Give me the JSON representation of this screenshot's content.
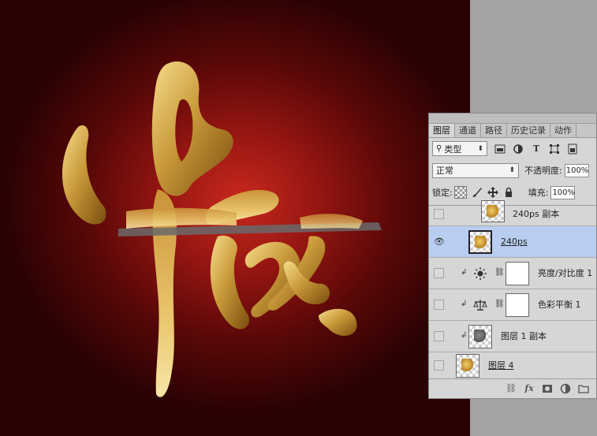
{
  "panel": {
    "tabs": [
      {
        "label": "图层",
        "active": true
      },
      {
        "label": "通道"
      },
      {
        "label": "路径"
      },
      {
        "label": "历史记录"
      },
      {
        "label": "动作"
      }
    ],
    "filter": {
      "kind_label": "类型"
    },
    "blend": {
      "mode": "正常",
      "opacity_label": "不透明度:",
      "opacity_value": "100%"
    },
    "lock": {
      "label": "锁定:",
      "fill_label": "填充:",
      "fill_value": "100%"
    },
    "layers": [
      {
        "name": "240ps 副本",
        "visible": false
      },
      {
        "name": "240ps",
        "visible": true,
        "selected": true
      },
      {
        "name": "亮度/对比度 1",
        "visible": false,
        "clipped": true,
        "icon": "sun-icon"
      },
      {
        "name": "色彩平衡 1",
        "visible": false,
        "clipped": true,
        "icon": "scales-icon"
      },
      {
        "name": "图层 1 副本",
        "visible": false,
        "clipped": true
      },
      {
        "name": "图层 4",
        "visible": false
      }
    ],
    "footer_icons": [
      "link-icon",
      "fx-icon",
      "add-mask-icon",
      "adjustment-icon",
      "folder-icon"
    ]
  },
  "colors": {
    "canvas_center": "#c8281f",
    "canvas_edge": "#2a0203",
    "gold_light": "#f3d98a",
    "gold_dark": "#8a5a12",
    "selection": "#b9cdf1"
  }
}
